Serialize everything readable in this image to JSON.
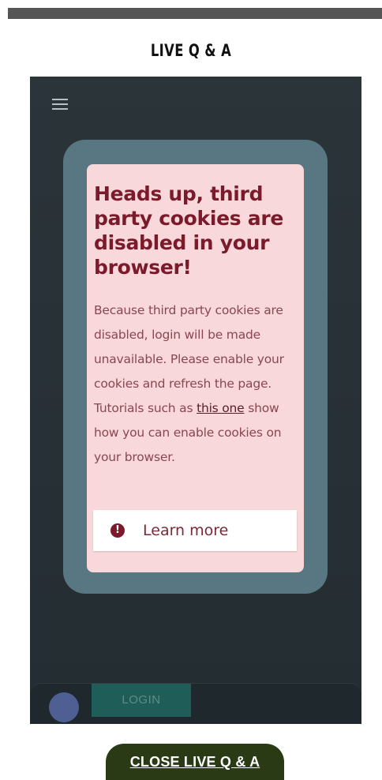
{
  "page": {
    "title": "LIVE Q & A"
  },
  "menu": {
    "icon": "hamburger-menu-icon"
  },
  "modal": {
    "heading": "Heads up, third party cookies are disabled in your browser!",
    "body_before_link": "Because third party cookies are disabled, login will be made unavailable. Please enable your cookies and refresh the page. Tutorials such as ",
    "link_text": "this one",
    "body_after_link": " show how you can enable cookies on your browser.",
    "learn_more_label": "Learn more",
    "learn_more_icon": "info-icon"
  },
  "bottom_bar": {
    "login_label": "LOGIN",
    "avatar_icon": "avatar-icon"
  },
  "footer": {
    "close_label": "CLOSE LIVE Q & A"
  },
  "colors": {
    "frame_bg": "#242d32",
    "modal_outer": "#597782",
    "modal_card": "#f8d8da",
    "heading_text": "#7a1a2a",
    "login_button": "#1f5e58",
    "close_button": "#2a3a14"
  }
}
